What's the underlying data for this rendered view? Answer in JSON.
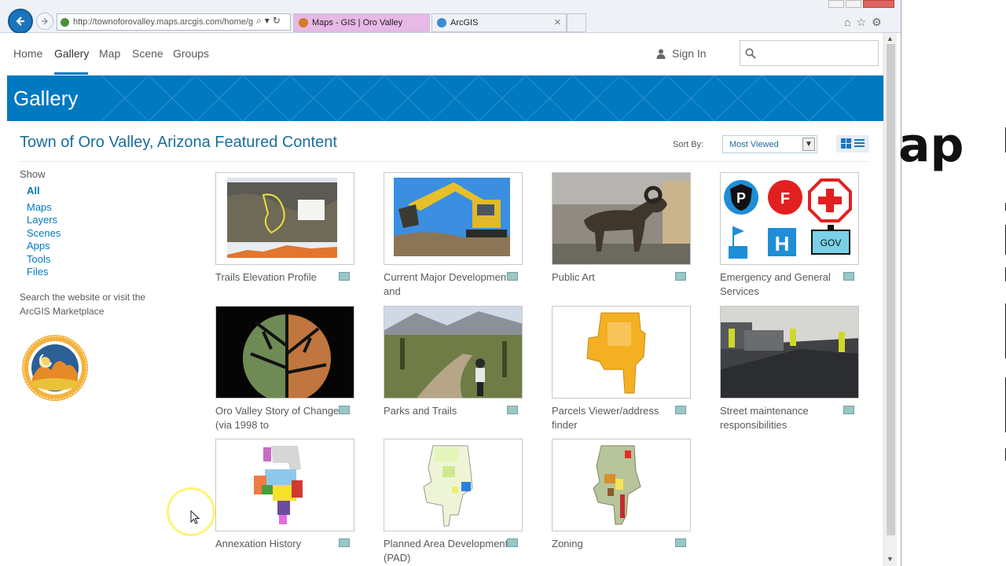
{
  "browser": {
    "address_url": "http://townoforovalley.maps.arcgis.com/home/g",
    "tabs": [
      {
        "label": "Maps - GIS | Oro Valley"
      },
      {
        "label": "ArcGIS"
      }
    ]
  },
  "topnav": {
    "links": [
      "Home",
      "Gallery",
      "Map",
      "Scene",
      "Groups"
    ],
    "active": "Gallery",
    "sign_in": "Sign In",
    "search_placeholder": ""
  },
  "banner": {
    "title": "Gallery"
  },
  "content": {
    "heading": "Town of Oro Valley, Arizona Featured Content",
    "sort_by_label": "Sort By:",
    "sort_selected": "Most Viewed"
  },
  "sidebar": {
    "show_label": "Show",
    "filters": [
      "All",
      "Maps",
      "Layers",
      "Scenes",
      "Apps",
      "Tools",
      "Files"
    ],
    "active_filter": "All",
    "note": "Search the website or visit the ArcGIS Marketplace",
    "seal_text_top": "ORO VALLEY ARIZONA",
    "seal_text_bottom": "FOUNDED 1974"
  },
  "gallery": [
    {
      "title": "Trails Elevation Profile"
    },
    {
      "title": "Current Major Development and"
    },
    {
      "title": "Public Art"
    },
    {
      "title": "Emergency and General Services"
    },
    {
      "title": "Oro Valley Story of Change (via 1998 to"
    },
    {
      "title": "Parks and Trails"
    },
    {
      "title": "Parcels Viewer/address finder"
    },
    {
      "title": "Street maintenance responsibilities"
    },
    {
      "title": "Annexation History"
    },
    {
      "title": "Planned Area Development (PAD)"
    },
    {
      "title": "Zoning"
    }
  ],
  "emergency_icons": {
    "police": "P",
    "fire": "F",
    "hospital": "H",
    "gov": "GOV"
  },
  "outside_text": "ap",
  "colors": {
    "accent": "#0079c1",
    "heading": "#1b6e9a",
    "tab_active": "#e8b8e6"
  }
}
